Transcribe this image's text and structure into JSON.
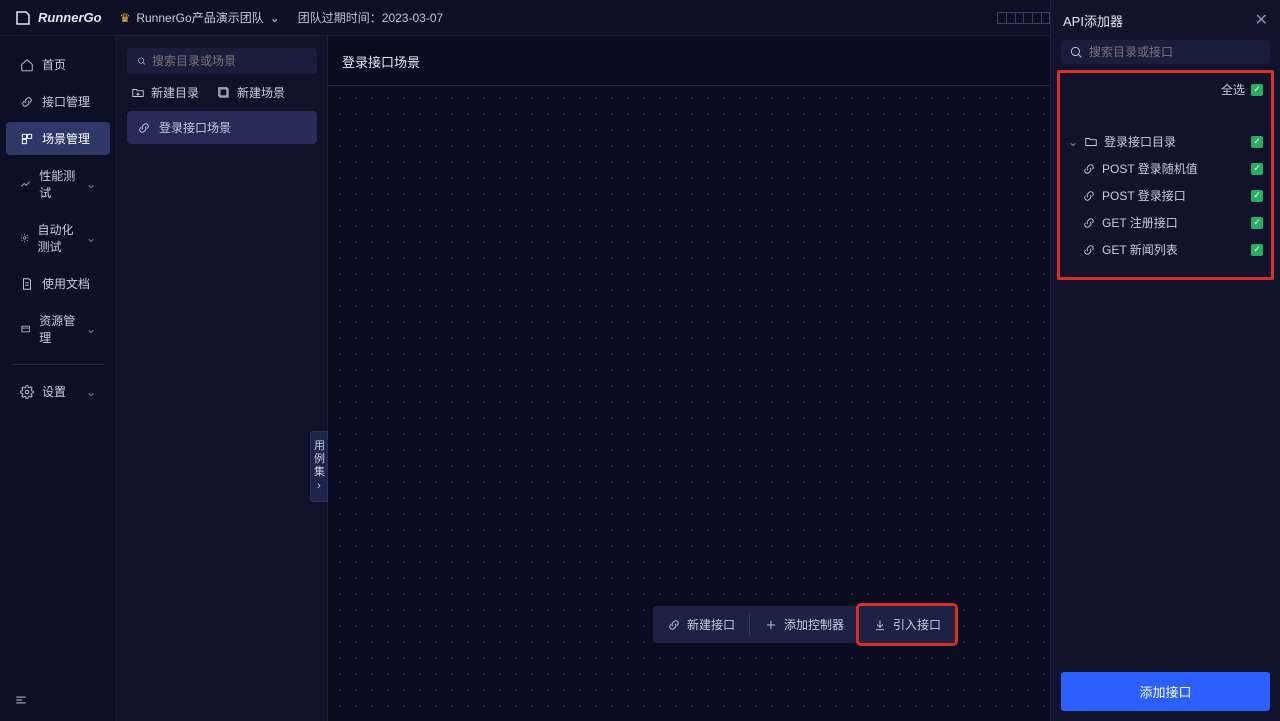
{
  "header": {
    "brand": "RunnerGo",
    "team": "RunnerGo产品演示团队",
    "expire_label": "团队过期时间：",
    "expire_date": "2023-03-07",
    "running_label": "运行中",
    "running_count": "(0)"
  },
  "sidebar": {
    "items": [
      {
        "label": "首页",
        "icon": "home"
      },
      {
        "label": "接口管理",
        "icon": "api"
      },
      {
        "label": "场景管理",
        "icon": "scene",
        "active": true
      },
      {
        "label": "性能测试",
        "icon": "perf",
        "expandable": true
      },
      {
        "label": "自动化测试",
        "icon": "auto",
        "expandable": true
      },
      {
        "label": "使用文档",
        "icon": "doc"
      },
      {
        "label": "资源管理",
        "icon": "resource",
        "expandable": true
      }
    ],
    "settings_label": "设置"
  },
  "tree": {
    "search_placeholder": "搜索目录或场景",
    "new_folder": "新建目录",
    "new_scene": "新建场景",
    "items": [
      {
        "label": "登录接口场景"
      }
    ]
  },
  "main": {
    "title": "登录接口场景",
    "case_tab": "用例集",
    "toolbar": {
      "new_api": "新建接口",
      "add_controller": "添加控制器",
      "import_api": "引入接口"
    }
  },
  "panel": {
    "title": "API添加器",
    "search_placeholder": "搜索目录或接口",
    "select_all": "全选",
    "nodes": [
      {
        "label": "登录接口目录",
        "kind": "folder",
        "indent": false
      },
      {
        "label": "POST 登录随机值",
        "kind": "api",
        "indent": true
      },
      {
        "label": "POST 登录接口",
        "kind": "api",
        "indent": true
      },
      {
        "label": "GET 注册接口",
        "kind": "api",
        "indent": true
      },
      {
        "label": "GET 新闻列表",
        "kind": "api",
        "indent": true
      }
    ],
    "add_button": "添加接口"
  }
}
